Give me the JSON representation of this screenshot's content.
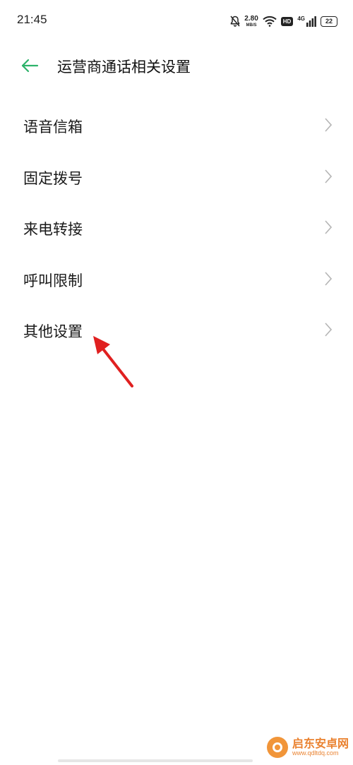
{
  "status_bar": {
    "time": "21:45",
    "speed_value": "2.80",
    "speed_unit": "MB/S",
    "hd": "HD",
    "network": "4G",
    "battery": "22",
    "icons": [
      "bell-muted-icon",
      "wifi-icon",
      "hd-icon",
      "signal-icon",
      "battery-icon"
    ]
  },
  "header": {
    "title": "运营商通话相关设置",
    "back_icon": "back-arrow-icon"
  },
  "menu": {
    "items": [
      {
        "label": "语音信箱"
      },
      {
        "label": "固定拨号"
      },
      {
        "label": "来电转接"
      },
      {
        "label": "呼叫限制"
      },
      {
        "label": "其他设置"
      }
    ]
  },
  "watermark": {
    "name": "启东安卓网",
    "url": "www.qdltdq.com"
  },
  "colors": {
    "accent": "#2db36a",
    "annotation": "#e02020",
    "chevron": "#b5b5b5"
  }
}
